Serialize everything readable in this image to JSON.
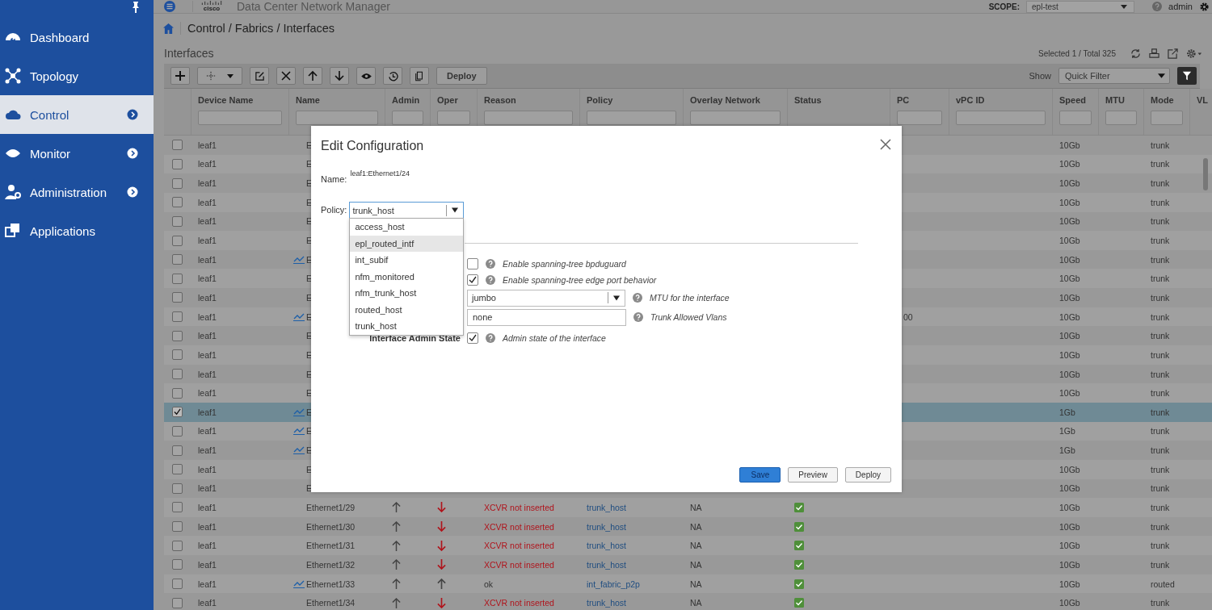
{
  "header": {
    "logo_text": "cisco",
    "app_title": "Data Center Network Manager",
    "scope_label": "SCOPE:",
    "scope_value": "epl-test",
    "user": "admin"
  },
  "sidebar": {
    "items": [
      {
        "label": "Dashboard",
        "selected": false,
        "has_submenu": false
      },
      {
        "label": "Topology",
        "selected": false,
        "has_submenu": false
      },
      {
        "label": "Control",
        "selected": true,
        "has_submenu": true
      },
      {
        "label": "Monitor",
        "selected": false,
        "has_submenu": true
      },
      {
        "label": "Administration",
        "selected": false,
        "has_submenu": true
      },
      {
        "label": "Applications",
        "selected": false,
        "has_submenu": false
      }
    ]
  },
  "breadcrumb": "Control / Fabrics / Interfaces",
  "page_title": "Interfaces",
  "selection_summary": "Selected 1 / Total 325",
  "toolbar": {
    "deploy_label": "Deploy",
    "show_label": "Show",
    "filter_value": "Quick Filter"
  },
  "table": {
    "columns": [
      {
        "label": "Device Name",
        "filter": true
      },
      {
        "label": "Name",
        "filter": true
      },
      {
        "label": "Admin",
        "filter": true
      },
      {
        "label": "Oper",
        "filter": true
      },
      {
        "label": "Reason",
        "filter": true
      },
      {
        "label": "Policy",
        "filter": true
      },
      {
        "label": "Overlay Network",
        "filter": true
      },
      {
        "label": "Status",
        "filter": false
      },
      {
        "label": "PC",
        "filter": true
      },
      {
        "label": "vPC ID",
        "filter": true
      },
      {
        "label": "Speed",
        "filter": true
      },
      {
        "label": "MTU",
        "filter": true
      },
      {
        "label": "Mode",
        "filter": true
      },
      {
        "label": "VL",
        "filter": false
      }
    ],
    "rows": [
      {
        "selected": false,
        "device": "leaf1",
        "name": "E",
        "trend": false,
        "speed": "10Gb",
        "mode": "trunk"
      },
      {
        "selected": false,
        "device": "leaf1",
        "name": "E",
        "trend": false,
        "speed": "10Gb",
        "mode": "trunk"
      },
      {
        "selected": false,
        "device": "leaf1",
        "name": "E",
        "trend": false,
        "speed": "10Gb",
        "mode": "trunk"
      },
      {
        "selected": false,
        "device": "leaf1",
        "name": "E",
        "trend": false,
        "speed": "10Gb",
        "mode": "trunk"
      },
      {
        "selected": false,
        "device": "leaf1",
        "name": "E",
        "trend": false,
        "speed": "10Gb",
        "mode": "trunk"
      },
      {
        "selected": false,
        "device": "leaf1",
        "name": "E",
        "trend": false,
        "speed": "10Gb",
        "mode": "trunk"
      },
      {
        "selected": false,
        "device": "leaf1",
        "name": "E",
        "trend": true,
        "speed": "10Gb",
        "mode": "trunk"
      },
      {
        "selected": false,
        "device": "leaf1",
        "name": "E",
        "trend": false,
        "speed": "10Gb",
        "mode": "trunk"
      },
      {
        "selected": false,
        "device": "leaf1",
        "name": "E",
        "trend": false,
        "speed": "10Gb",
        "mode": "trunk"
      },
      {
        "selected": false,
        "device": "leaf1",
        "name": "E",
        "trend": true,
        "pc": "00",
        "speed": "10Gb",
        "mode": "trunk"
      },
      {
        "selected": false,
        "device": "leaf1",
        "name": "E",
        "trend": false,
        "speed": "10Gb",
        "mode": "trunk"
      },
      {
        "selected": false,
        "device": "leaf1",
        "name": "E",
        "trend": false,
        "speed": "10Gb",
        "mode": "trunk"
      },
      {
        "selected": false,
        "device": "leaf1",
        "name": "E",
        "trend": false,
        "speed": "10Gb",
        "mode": "trunk"
      },
      {
        "selected": false,
        "device": "leaf1",
        "name": "E",
        "trend": false,
        "speed": "10Gb",
        "mode": "trunk"
      },
      {
        "selected": true,
        "device": "leaf1",
        "name": "E",
        "trend": true,
        "speed": "1Gb",
        "mode": "trunk"
      },
      {
        "selected": false,
        "device": "leaf1",
        "name": "E",
        "trend": true,
        "speed": "1Gb",
        "mode": "trunk"
      },
      {
        "selected": false,
        "device": "leaf1",
        "name": "E",
        "trend": true,
        "speed": "1Gb",
        "mode": "trunk"
      },
      {
        "selected": false,
        "device": "leaf1",
        "name": "E",
        "trend": false,
        "speed": "10Gb",
        "mode": "trunk"
      },
      {
        "selected": false,
        "device": "leaf1",
        "name": "E",
        "trend": false,
        "speed": "10Gb",
        "mode": "trunk"
      },
      {
        "selected": false,
        "device": "leaf1",
        "name": "Ethernet1/29",
        "trend": false,
        "admin_up": true,
        "oper_up": false,
        "reason": "XCVR not inserted",
        "policy": "trunk_host",
        "overlay": "NA",
        "status": true,
        "speed": "10Gb",
        "mode": "trunk"
      },
      {
        "selected": false,
        "device": "leaf1",
        "name": "Ethernet1/30",
        "trend": false,
        "admin_up": true,
        "oper_up": false,
        "reason": "XCVR not inserted",
        "policy": "trunk_host",
        "overlay": "NA",
        "status": true,
        "speed": "10Gb",
        "mode": "trunk"
      },
      {
        "selected": false,
        "device": "leaf1",
        "name": "Ethernet1/31",
        "trend": false,
        "admin_up": true,
        "oper_up": false,
        "reason": "XCVR not inserted",
        "policy": "trunk_host",
        "overlay": "NA",
        "status": true,
        "speed": "10Gb",
        "mode": "trunk"
      },
      {
        "selected": false,
        "device": "leaf1",
        "name": "Ethernet1/32",
        "trend": false,
        "admin_up": true,
        "oper_up": false,
        "reason": "XCVR not inserted",
        "policy": "trunk_host",
        "overlay": "NA",
        "status": true,
        "speed": "10Gb",
        "mode": "trunk"
      },
      {
        "selected": false,
        "device": "leaf1",
        "name": "Ethernet1/33",
        "trend": true,
        "admin_up": true,
        "oper_up": true,
        "reason": "ok",
        "policy": "int_fabric_p2p",
        "overlay": "NA",
        "status": true,
        "speed": "10Gb",
        "mode": "routed"
      },
      {
        "selected": false,
        "device": "leaf1",
        "name": "Ethernet1/34",
        "trend": false,
        "admin_up": true,
        "oper_up": false,
        "reason": "XCVR not inserted",
        "policy": "trunk_host",
        "overlay": "NA",
        "status": true,
        "speed": "10Gb",
        "mode": "trunk"
      }
    ]
  },
  "dialog": {
    "title": "Edit Configuration",
    "name_label": "Name:",
    "name_value": "leaf1:Ethernet1/24",
    "policy_label": "Policy:",
    "policy_value": "trunk_host",
    "policy_options": [
      {
        "label": "access_host",
        "highlighted": false
      },
      {
        "label": "epl_routed_intf",
        "highlighted": true
      },
      {
        "label": "int_subif",
        "highlighted": false
      },
      {
        "label": "nfm_monitored",
        "highlighted": false
      },
      {
        "label": "nfm_trunk_host",
        "highlighted": false
      },
      {
        "label": "routed_host",
        "highlighted": false
      },
      {
        "label": "trunk_host",
        "highlighted": false
      }
    ],
    "fields": [
      {
        "kind": "checkbox",
        "checked": false,
        "help": "Enable spanning-tree bpduguard"
      },
      {
        "kind": "checkbox",
        "checked": true,
        "help": "Enable spanning-tree edge port behavior"
      },
      {
        "kind": "select",
        "value": "jumbo",
        "help": "MTU for the interface"
      },
      {
        "kind": "text",
        "value": "none",
        "help": "Trunk Allowed Vlans"
      },
      {
        "kind": "checkbox",
        "label": "Interface Admin State",
        "checked": true,
        "help": "Admin state of the interface"
      }
    ],
    "buttons": [
      {
        "label": "Save",
        "primary": true
      },
      {
        "label": "Preview",
        "primary": false
      },
      {
        "label": "Deploy",
        "primary": false
      }
    ]
  }
}
